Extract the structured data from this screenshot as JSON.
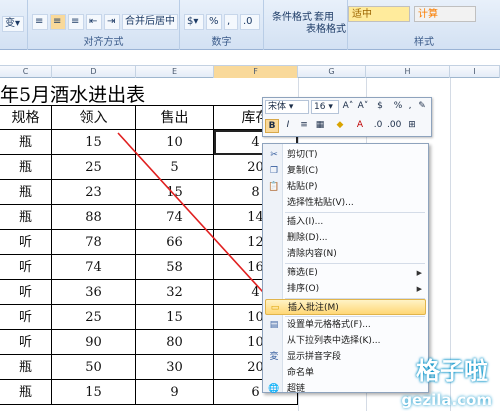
{
  "ribbon": {
    "groups": [
      {
        "label": ""
      },
      {
        "label": "对齐方式"
      },
      {
        "label": "数字"
      },
      {
        "label": ""
      },
      {
        "label": "样式"
      }
    ],
    "merge_label": "合并后居中",
    "conditional_label": "条件格式",
    "table_format_label": "表格格式",
    "apply_label": "套用",
    "style_neutral": "适中",
    "style_calc": "计算",
    "number_pct": "%",
    "number_comma": ","
  },
  "columns": [
    "C",
    "D",
    "E",
    "F",
    "G",
    "H",
    "I"
  ],
  "sheet": {
    "title": "年5月酒水进出表",
    "headers": [
      "规格",
      "领入",
      "售出",
      "库存"
    ],
    "rows": [
      [
        "瓶",
        "15",
        "10",
        "4"
      ],
      [
        "瓶",
        "25",
        "5",
        "20"
      ],
      [
        "瓶",
        "23",
        "15",
        "8"
      ],
      [
        "瓶",
        "88",
        "74",
        "14"
      ],
      [
        "听",
        "78",
        "66",
        "12"
      ],
      [
        "听",
        "74",
        "58",
        "16"
      ],
      [
        "听",
        "36",
        "32",
        "4"
      ],
      [
        "听",
        "25",
        "15",
        "10"
      ],
      [
        "听",
        "90",
        "80",
        "10"
      ],
      [
        "瓶",
        "50",
        "30",
        "20"
      ],
      [
        "瓶",
        "15",
        "9",
        "6"
      ]
    ]
  },
  "mini_toolbar": {
    "font": "宋体",
    "size": "16",
    "bold": "B",
    "italic": "I"
  },
  "context_menu": {
    "items": [
      {
        "label": "剪切(T)",
        "icon": "scissors-icon"
      },
      {
        "label": "复制(C)",
        "icon": "copy-icon"
      },
      {
        "label": "粘贴(P)",
        "icon": "paste-icon"
      },
      {
        "label": "选择性粘贴(V)...",
        "icon": ""
      },
      {
        "label": "插入(I)...",
        "icon": ""
      },
      {
        "label": "删除(D)...",
        "icon": ""
      },
      {
        "label": "清除内容(N)",
        "icon": ""
      },
      {
        "label": "筛选(E)",
        "icon": ""
      },
      {
        "label": "排序(O)",
        "icon": ""
      },
      {
        "label": "插入批注(M)",
        "icon": "comment-icon"
      },
      {
        "label": "设置单元格格式(F)...",
        "icon": "format-cells-icon"
      },
      {
        "label": "从下拉列表中选择(K)...",
        "icon": ""
      },
      {
        "label": "显示拼音字段",
        "icon": "phonetic-icon"
      },
      {
        "label": "命名单",
        "icon": ""
      },
      {
        "label": "超链",
        "icon": "hyperlink-icon"
      }
    ]
  },
  "watermark": {
    "main": "格子啦",
    "sub": "gezila.com"
  },
  "colors": {
    "highlight": "#ffd776",
    "arrow": "#e02020",
    "watermark": "#0090c8"
  }
}
